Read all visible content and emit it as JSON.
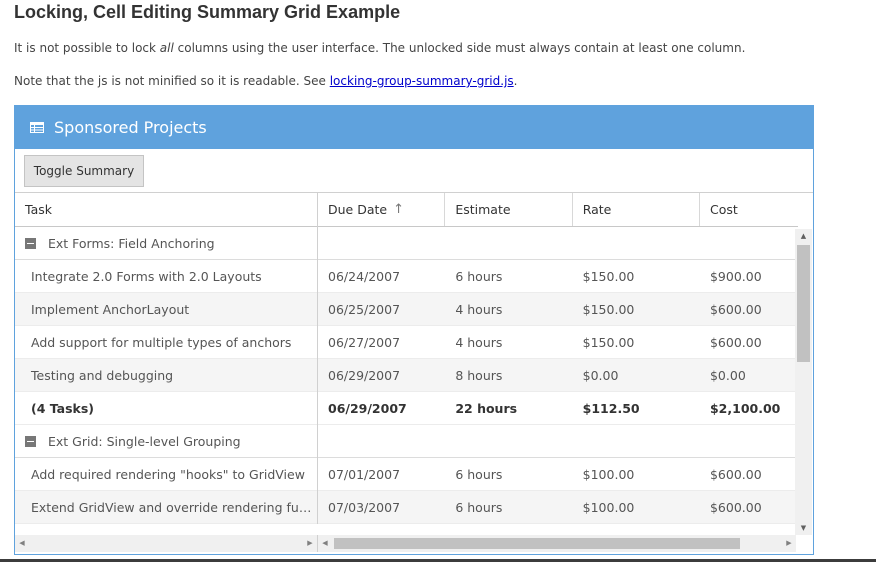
{
  "page": {
    "title": "Locking, Cell Editing Summary Grid Example",
    "desc1_pre": "It is not possible to lock ",
    "desc1_em": "all",
    "desc1_post": " columns using the user interface. The unlocked side must always contain at least one column.",
    "desc2_pre": "Note that the js is not minified so it is readable. See ",
    "desc2_link": "locking-group-summary-grid.js",
    "desc2_post": "."
  },
  "panel": {
    "title": "Sponsored Projects",
    "icon": "grid-icon",
    "toggle_label": "Toggle Summary"
  },
  "columns": {
    "task": "Task",
    "due": "Due Date",
    "estimate": "Estimate",
    "rate": "Rate",
    "cost": "Cost",
    "sort_icon": "sort-ascending-icon"
  },
  "groups": [
    {
      "name": "Ext Forms: Field Anchoring",
      "rows": [
        {
          "task": "Integrate 2.0 Forms with 2.0 Layouts",
          "due": "06/24/2007",
          "estimate": "6 hours",
          "rate": "$150.00",
          "cost": "$900.00"
        },
        {
          "task": "Implement AnchorLayout",
          "due": "06/25/2007",
          "estimate": "4 hours",
          "rate": "$150.00",
          "cost": "$600.00"
        },
        {
          "task": "Add support for multiple types of anchors",
          "due": "06/27/2007",
          "estimate": "4 hours",
          "rate": "$150.00",
          "cost": "$600.00"
        },
        {
          "task": "Testing and debugging",
          "due": "06/29/2007",
          "estimate": "8 hours",
          "rate": "$0.00",
          "cost": "$0.00"
        }
      ],
      "summary": {
        "task": "(4 Tasks)",
        "due": "06/29/2007",
        "estimate": "22 hours",
        "rate": "$112.50",
        "cost": "$2,100.00"
      }
    },
    {
      "name": "Ext Grid: Single-level Grouping",
      "rows": [
        {
          "task": "Add required rendering \"hooks\" to GridView",
          "due": "07/01/2007",
          "estimate": "6 hours",
          "rate": "$100.00",
          "cost": "$600.00"
        },
        {
          "task": "Extend GridView and override rendering functions",
          "due": "07/03/2007",
          "estimate": "6 hours",
          "rate": "$100.00",
          "cost": "$600.00"
        }
      ]
    }
  ]
}
